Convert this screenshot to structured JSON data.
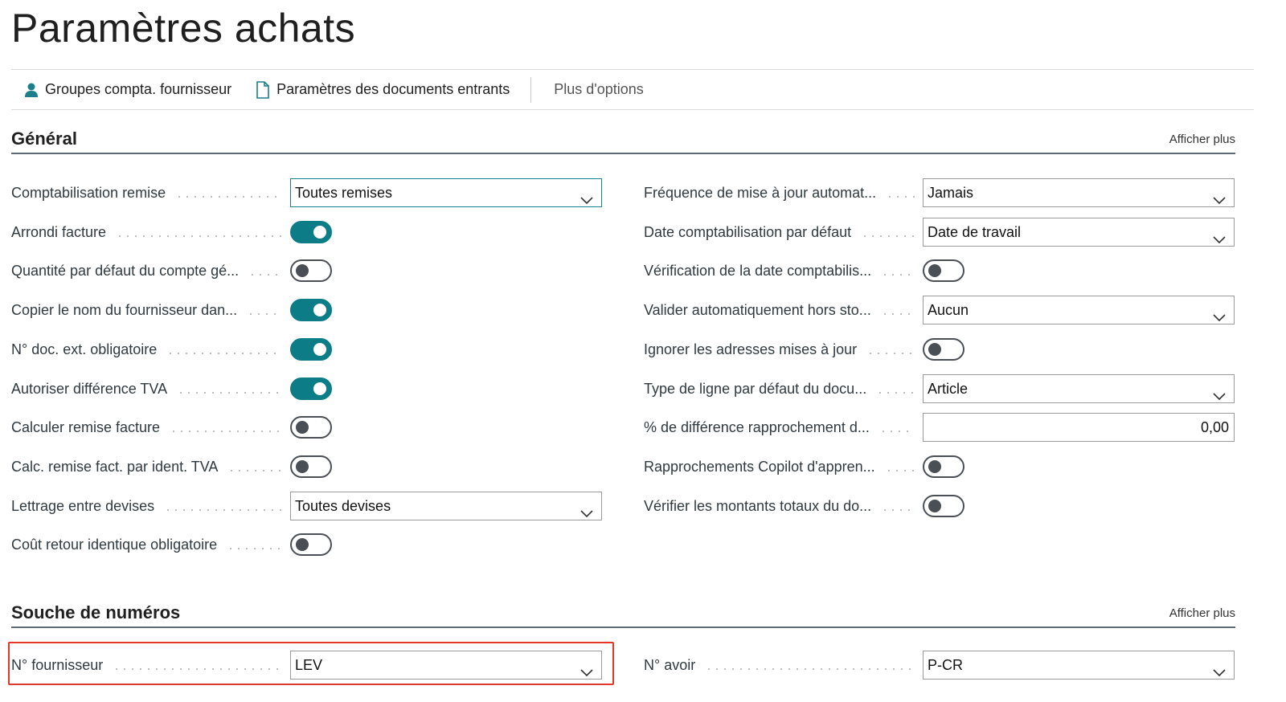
{
  "page": {
    "title": "Paramètres achats"
  },
  "actions": {
    "vendor_posting_groups": "Groupes compta. fournisseur",
    "incoming_doc_setup": "Paramètres des documents entrants",
    "more_options": "Plus d'options"
  },
  "general": {
    "title": "Général",
    "show_more": "Afficher plus",
    "left": [
      {
        "label": "Comptabilisation remise",
        "type": "select",
        "value": "Toutes remises"
      },
      {
        "label": "Arrondi facture",
        "type": "toggle",
        "on": true
      },
      {
        "label": "Quantité par défaut du compte gé...",
        "type": "toggle",
        "on": false
      },
      {
        "label": "Copier le nom du fournisseur dan...",
        "type": "toggle",
        "on": true
      },
      {
        "label": "N° doc. ext. obligatoire",
        "type": "toggle",
        "on": true
      },
      {
        "label": "Autoriser différence TVA",
        "type": "toggle",
        "on": true
      },
      {
        "label": "Calculer remise facture",
        "type": "toggle",
        "on": false
      },
      {
        "label": "Calc. remise fact. par ident. TVA",
        "type": "toggle",
        "on": false
      },
      {
        "label": "Lettrage entre devises",
        "type": "select",
        "value": "Toutes devises"
      },
      {
        "label": "Coût retour identique obligatoire",
        "type": "toggle",
        "on": false
      }
    ],
    "right": [
      {
        "label": "Fréquence de mise à jour automat...",
        "type": "select",
        "value": "Jamais"
      },
      {
        "label": "Date comptabilisation par défaut",
        "type": "select",
        "value": "Date de travail"
      },
      {
        "label": "Vérification de la date comptabilis...",
        "type": "toggle",
        "on": false
      },
      {
        "label": "Valider automatiquement hors sto...",
        "type": "select",
        "value": "Aucun"
      },
      {
        "label": "Ignorer les adresses mises à jour",
        "type": "toggle",
        "on": false
      },
      {
        "label": "Type de ligne par défaut du docu...",
        "type": "select",
        "value": "Article"
      },
      {
        "label": "% de différence rapprochement d...",
        "type": "number",
        "value": "0,00"
      },
      {
        "label": "Rapprochements Copilot d'appren...",
        "type": "toggle",
        "on": false
      },
      {
        "label": "Vérifier les montants totaux du do...",
        "type": "toggle",
        "on": false
      }
    ]
  },
  "number_series": {
    "title": "Souche de numéros",
    "show_more": "Afficher plus",
    "left": [
      {
        "label": "N° fournisseur",
        "type": "select",
        "value": "LEV"
      }
    ],
    "right": [
      {
        "label": "N° avoir",
        "type": "select",
        "value": "P-CR"
      }
    ]
  },
  "colors": {
    "accent": "#0c7d86",
    "highlight": "#e4372b",
    "icon": "#1b7f8c"
  }
}
